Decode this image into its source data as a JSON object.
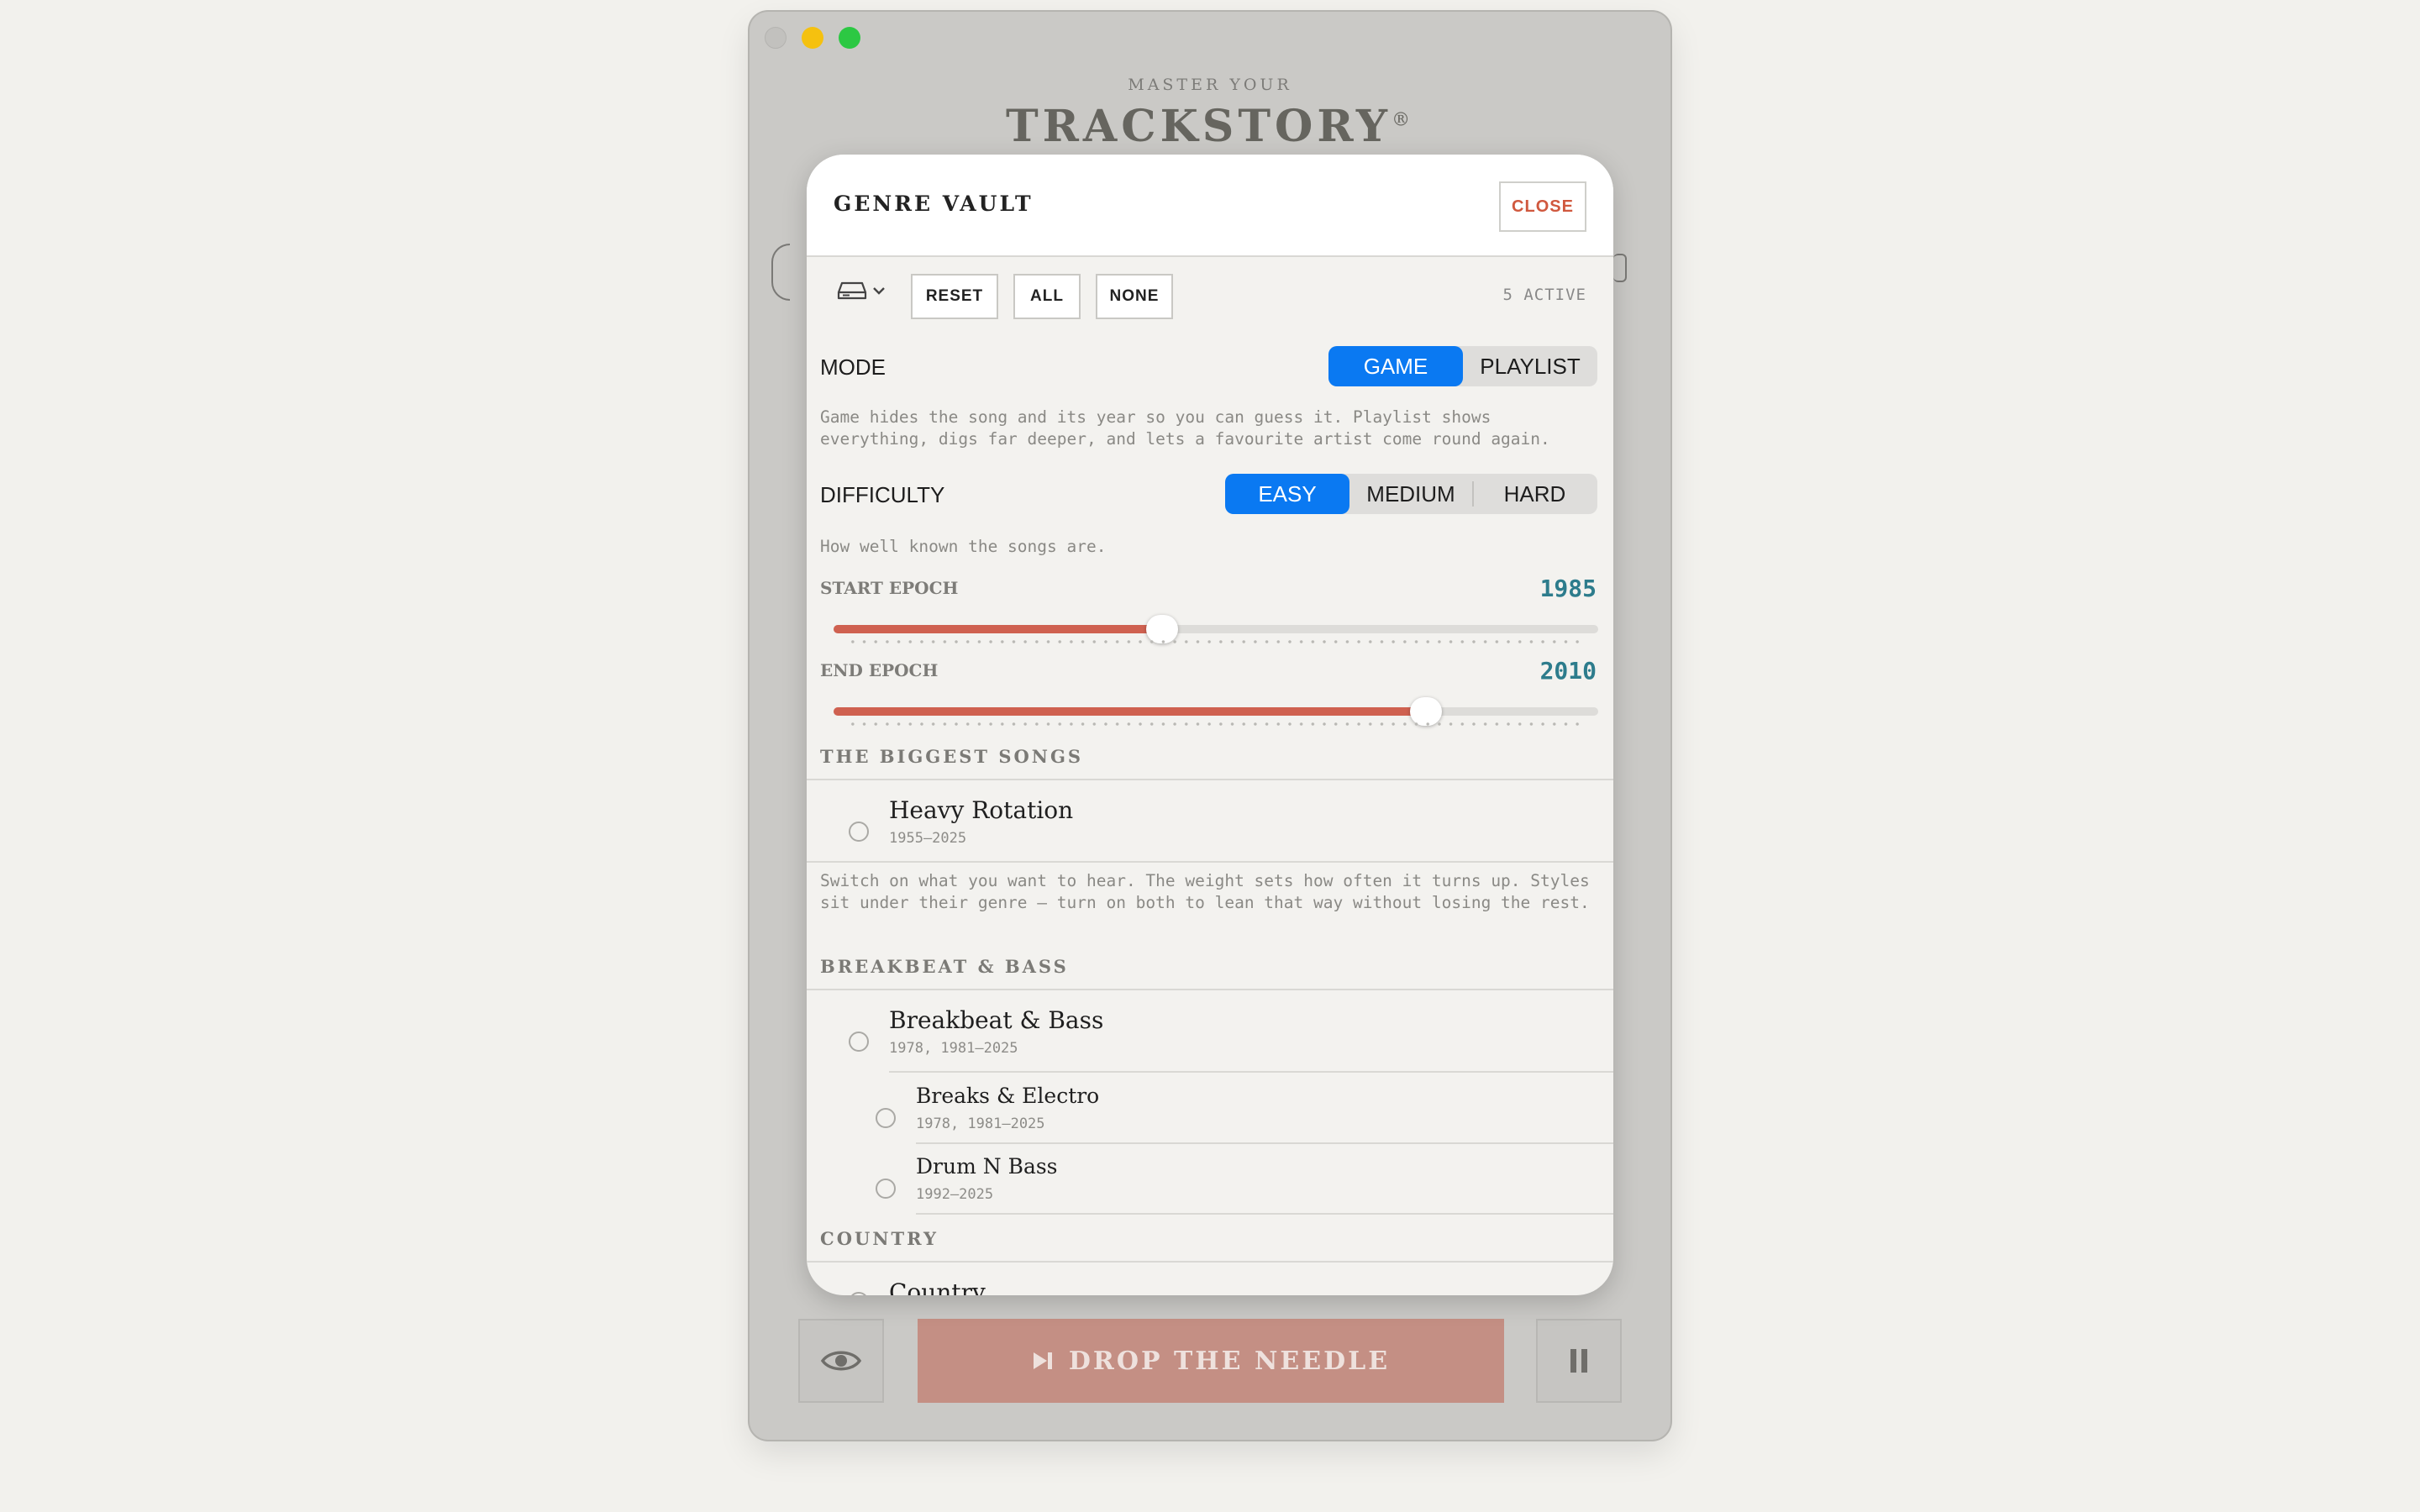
{
  "app": {
    "brand_sub": "MASTER YOUR",
    "brand_title": "TRACKSTORY",
    "brand_mark": "®",
    "drop_label": "DROP THE NEEDLE"
  },
  "icons": {
    "drive": "drive-icon",
    "eye": "eye-icon",
    "skip": "skip-forward-icon",
    "pause": "pause-icon"
  },
  "colors": {
    "accent_blue": "#0a79f2",
    "slider_fill": "#cf6150",
    "close_red": "#d0583e",
    "epoch_value": "#2d7c8c"
  },
  "sheet": {
    "title": "GENRE VAULT",
    "close_label": "CLOSE",
    "toolbar": {
      "reset": "RESET",
      "all": "ALL",
      "none": "NONE",
      "active_count": "5 ACTIVE"
    },
    "mode": {
      "label": "MODE",
      "options": [
        "GAME",
        "PLAYLIST"
      ],
      "selected": "GAME",
      "help": "Game hides the song and its year so you can guess it. Playlist shows everything, digs far deeper, and lets a favourite artist come round again."
    },
    "difficulty": {
      "label": "DIFFICULTY",
      "options": [
        "EASY",
        "MEDIUM",
        "HARD"
      ],
      "selected": "EASY",
      "help": "How well known the songs are."
    },
    "start_epoch": {
      "label": "START EPOCH",
      "value": "1985",
      "fraction": 0.43
    },
    "end_epoch": {
      "label": "END EPOCH",
      "value": "2010",
      "fraction": 0.775
    },
    "biggest": {
      "header": "THE BIGGEST SONGS",
      "items": [
        {
          "name": "Heavy Rotation",
          "years": "1955–2025"
        }
      ],
      "help": "Switch on what you want to hear. The weight sets how often it turns up. Styles sit under their genre — turn on both to lean that way without losing the rest."
    },
    "sections": [
      {
        "header": "BREAKBEAT & BASS",
        "genre": {
          "name": "Breakbeat & Bass",
          "years": "1978, 1981–2025"
        },
        "styles": [
          {
            "name": "Breaks & Electro",
            "years": "1978, 1981–2025"
          },
          {
            "name": "Drum N Bass",
            "years": "1992–2025"
          }
        ]
      },
      {
        "header": "COUNTRY",
        "genre": {
          "name": "Country",
          "years": ""
        },
        "styles": []
      }
    ]
  }
}
